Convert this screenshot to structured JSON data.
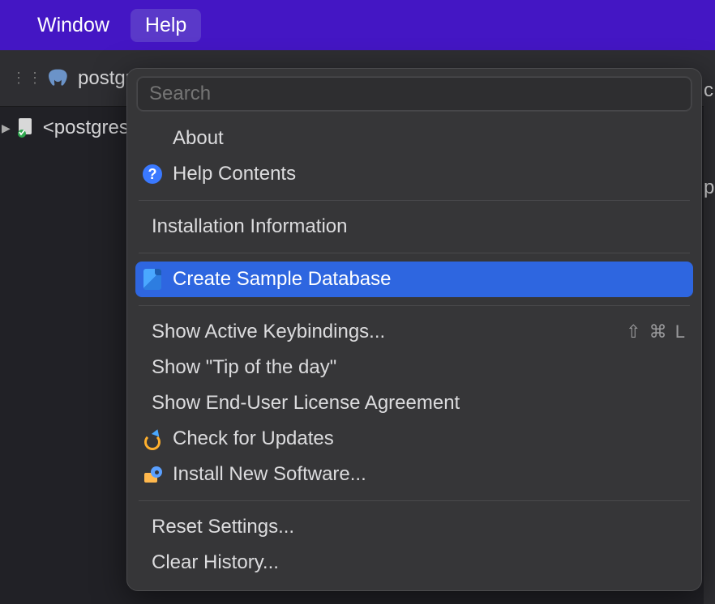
{
  "menubar": {
    "items": [
      {
        "label": "Window",
        "active": false
      },
      {
        "label": "Help",
        "active": true
      }
    ]
  },
  "toolbar": {
    "tab_label": "postgre"
  },
  "tree": {
    "item_label": "<postgres"
  },
  "right_edge": {
    "top": "c",
    "mid": "p"
  },
  "help_menu": {
    "search_placeholder": "Search",
    "groups": [
      {
        "items": [
          {
            "label": "About",
            "icon": null,
            "shortcut": null,
            "selected": false
          },
          {
            "label": "Help Contents",
            "icon": "help-circle",
            "shortcut": null,
            "selected": false
          }
        ]
      },
      {
        "items": [
          {
            "label": "Installation Information",
            "icon": null,
            "shortcut": null,
            "selected": false
          }
        ]
      },
      {
        "items": [
          {
            "label": "Create Sample Database",
            "icon": "db-sheet",
            "shortcut": null,
            "selected": true
          }
        ]
      },
      {
        "items": [
          {
            "label": "Show Active Keybindings...",
            "icon": null,
            "shortcut": "⇧ ⌘ L",
            "selected": false
          },
          {
            "label": "Show \"Tip of the day\"",
            "icon": null,
            "shortcut": null,
            "selected": false
          },
          {
            "label": "Show End-User License Agreement",
            "icon": null,
            "shortcut": null,
            "selected": false
          },
          {
            "label": "Check for Updates",
            "icon": "update-icon",
            "shortcut": null,
            "selected": false
          },
          {
            "label": "Install New Software...",
            "icon": "install-icon",
            "shortcut": null,
            "selected": false
          }
        ]
      },
      {
        "items": [
          {
            "label": "Reset Settings...",
            "icon": null,
            "shortcut": null,
            "selected": false
          },
          {
            "label": "Clear History...",
            "icon": null,
            "shortcut": null,
            "selected": false
          }
        ]
      }
    ]
  }
}
